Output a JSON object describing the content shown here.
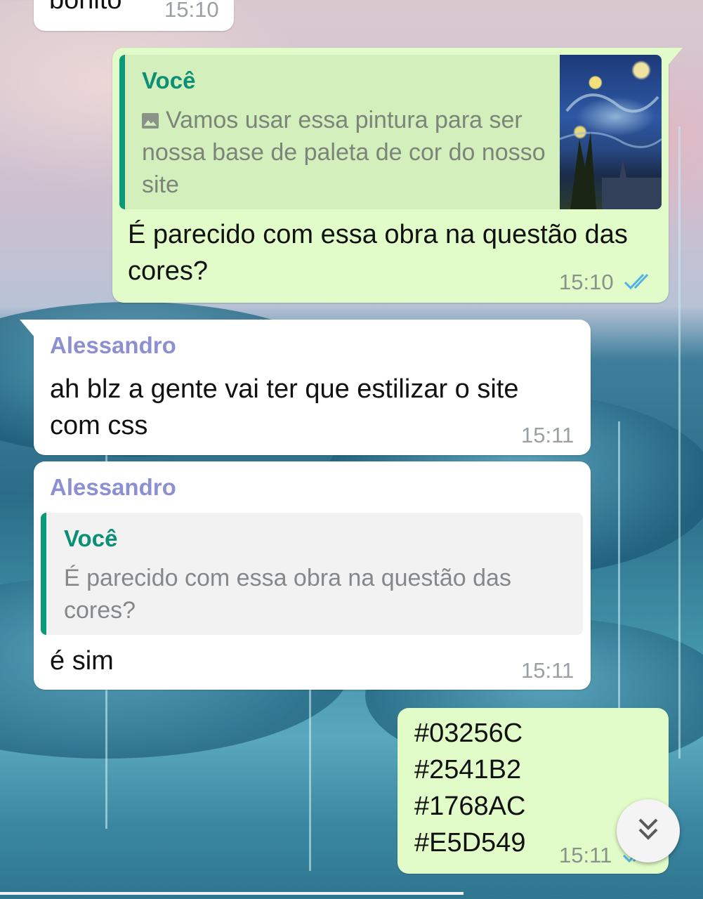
{
  "colors": {
    "outgoing_bubble": "#e1fcc8",
    "incoming_bubble": "#ffffff",
    "quote_accent": "#0a9a7a",
    "sender_name": "#8c8fd1",
    "read_ticks": "#4fb3e8"
  },
  "messages": [
    {
      "direction": "in",
      "text": "bonito",
      "time": "15:10"
    },
    {
      "direction": "out",
      "quote": {
        "author": "Você",
        "icon": "image-icon",
        "text": "Vamos usar essa pintura para ser nossa base de paleta de cor do nosso site",
        "thumbnail": "starry-night-thumbnail"
      },
      "text": "É parecido com essa obra na questão das cores?",
      "time": "15:10",
      "status": "read"
    },
    {
      "direction": "in",
      "sender": "Alessandro",
      "text": "ah blz a gente vai ter que estilizar o site com css",
      "time": "15:11"
    },
    {
      "direction": "in",
      "sender": "Alessandro",
      "quote": {
        "author": "Você",
        "text": "É parecido com essa obra na questão das cores?"
      },
      "text": "é sim",
      "time": "15:11"
    },
    {
      "direction": "out",
      "lines": [
        "#03256C",
        "#2541B2",
        "#1768AC",
        "#E5D549"
      ],
      "time": "15:11",
      "status": "read"
    }
  ],
  "scroll_button": {
    "icon": "chevron-double-down-icon"
  }
}
